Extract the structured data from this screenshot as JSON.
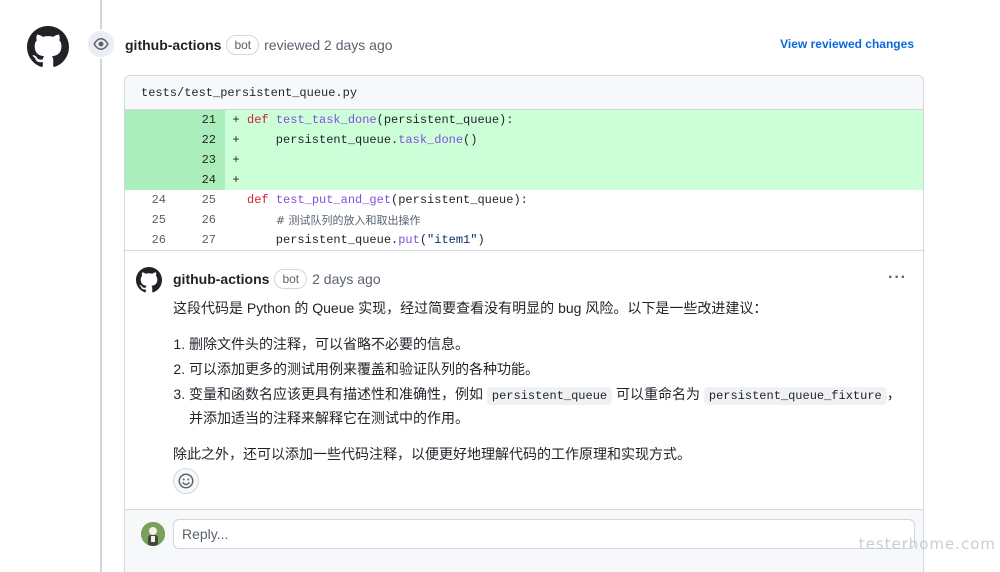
{
  "review": {
    "author": "github-actions",
    "badge": "bot",
    "action": "reviewed 2 days ago",
    "view_changes_label": "View reviewed changes"
  },
  "file": {
    "path": "tests/test_persistent_queue.py",
    "lines": [
      {
        "old": "",
        "new": "21",
        "marker": "+",
        "added": true,
        "tokens": [
          {
            "t": "def ",
            "c": "kw"
          },
          {
            "t": "test_task_done",
            "c": "fn"
          },
          {
            "t": "(persistent_queue):",
            "c": ""
          }
        ]
      },
      {
        "old": "",
        "new": "22",
        "marker": "+",
        "added": true,
        "tokens": [
          {
            "t": "    persistent_queue.",
            "c": ""
          },
          {
            "t": "task_done",
            "c": "fn"
          },
          {
            "t": "()",
            "c": ""
          }
        ]
      },
      {
        "old": "",
        "new": "23",
        "marker": "+",
        "added": true,
        "tokens": []
      },
      {
        "old": "",
        "new": "24",
        "marker": "+",
        "added": true,
        "tokens": []
      },
      {
        "old": "24",
        "new": "25",
        "marker": "",
        "added": false,
        "tokens": [
          {
            "t": "def ",
            "c": "kw"
          },
          {
            "t": "test_put_and_get",
            "c": "fn"
          },
          {
            "t": "(persistent_queue):",
            "c": ""
          }
        ]
      },
      {
        "old": "25",
        "new": "26",
        "marker": "",
        "added": false,
        "tokens": [
          {
            "t": "    ",
            "c": ""
          },
          {
            "t": "# 测试队列的放入和取出操作",
            "c": "cm"
          }
        ]
      },
      {
        "old": "26",
        "new": "27",
        "marker": "",
        "added": false,
        "tokens": [
          {
            "t": "    persistent_queue.",
            "c": ""
          },
          {
            "t": "put",
            "c": "fn"
          },
          {
            "t": "(",
            "c": ""
          },
          {
            "t": "\"item1\"",
            "c": "str"
          },
          {
            "t": ")",
            "c": ""
          }
        ]
      }
    ]
  },
  "comment": {
    "author": "github-actions",
    "badge": "bot",
    "time": "2 days ago",
    "more_label": "···",
    "intro": "这段代码是 Python 的 Queue 实现，经过简要查看没有明显的 bug 风险。以下是一些改进建议：",
    "suggestions": [
      "删除文件头的注释，可以省略不必要的信息。",
      "可以添加更多的测试用例来覆盖和验证队列的各种功能。"
    ],
    "suggestion3": {
      "before": "变量和函数名应该更具有描述性和准确性，例如 ",
      "code1": "persistent_queue",
      "middle": " 可以重命名为 ",
      "code2": "persistent_queue_fixture",
      "after": "，并添加适当的注释来解释它在测试中的作用。"
    },
    "outro": "除此之外，还可以添加一些代码注释，以便更好地理解代码的工作原理和实现方式。"
  },
  "reply": {
    "placeholder": "Reply..."
  },
  "watermark": "testerhome.com",
  "icons": {
    "avatar": "github-mark-icon",
    "review_event": "eye-icon",
    "reaction": "smiley-icon"
  },
  "colors": {
    "added_line_bg": "#ccffd8",
    "added_num_bg": "#aceebb",
    "link": "#0969da",
    "keyword": "#cf222e",
    "function": "#8250df"
  }
}
